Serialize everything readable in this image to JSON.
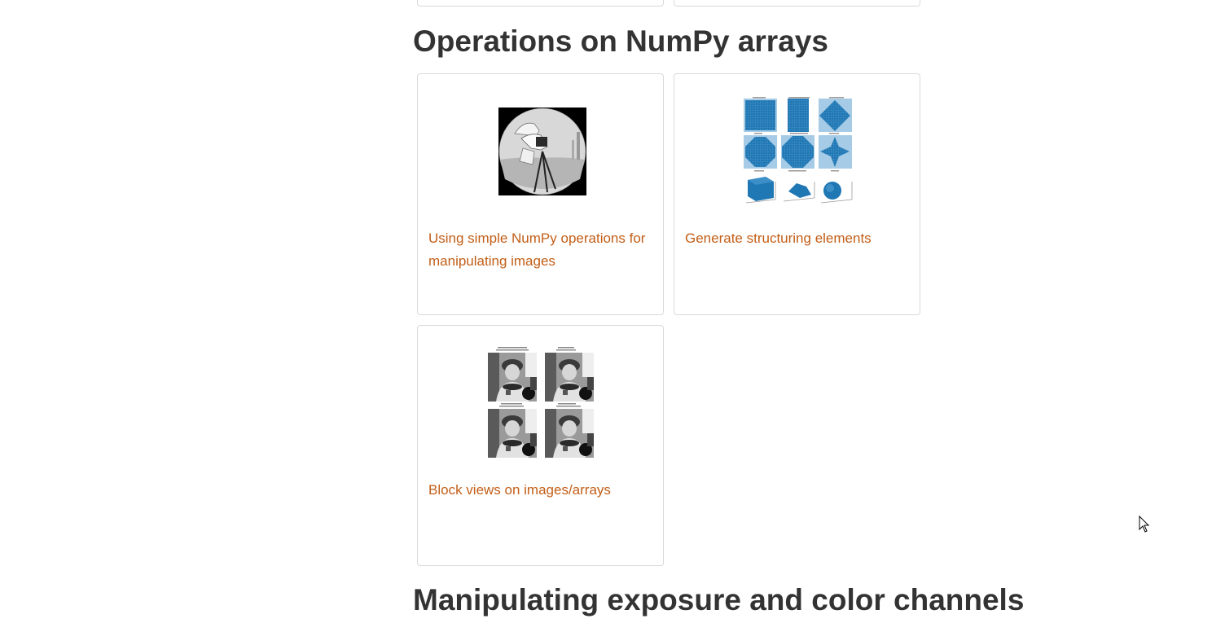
{
  "sections": [
    {
      "title": "Operations on NumPy arrays",
      "cards": [
        {
          "label": "Using simple NumPy operations for manipulating images",
          "thumbnail": "camera-masked-thumbnail"
        },
        {
          "label": "Generate structuring elements",
          "thumbnail": "structuring-elements-thumbnail"
        },
        {
          "label": "Block views on images/arrays",
          "thumbnail": "astronaut-block-views-thumbnail"
        }
      ]
    },
    {
      "title": "Manipulating exposure and color channels"
    }
  ],
  "colors": {
    "heading": "#333333",
    "link": "#c25e17",
    "card_border": "#d9d9d9",
    "thumb_blue": "#1f77b4"
  }
}
